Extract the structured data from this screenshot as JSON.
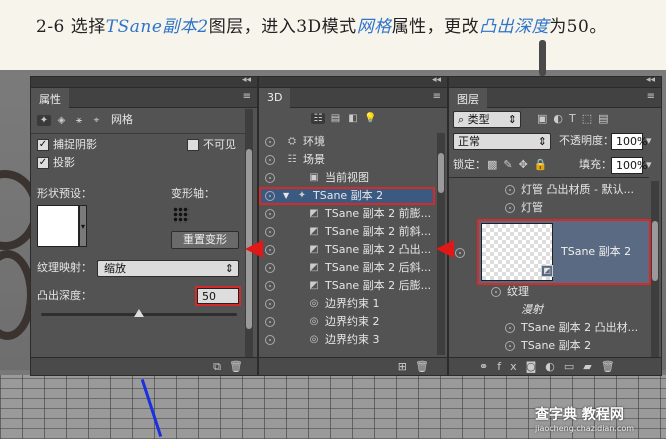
{
  "caption": {
    "prefix": "2-6 选择",
    "layer": "TSane副本2",
    "mid": "图层，进入3D模式",
    "mesh": "网格",
    "mid2": "属性，更改",
    "depth": "凸出深度",
    "suffix": "为50。"
  },
  "properties": {
    "tab": "属性",
    "mode_label": "网格",
    "catch_shadows": "捕捉阴影",
    "invisible": "不可见",
    "cast_shadows": "投影",
    "shape_preset": "形状预设：",
    "deform_axis": "变形轴：",
    "reset_button": "重置变形",
    "texture_label": "纹理映射：",
    "texture_value": "缩放",
    "extrusion_label": "凸出深度：",
    "extrusion_value": "50",
    "slider_fraction": 0.5
  },
  "panel3d": {
    "tab": "3D",
    "items": [
      {
        "icon": "env-icon",
        "label": "环境",
        "indent": 0
      },
      {
        "icon": "scene-icon",
        "label": "场景",
        "indent": 0
      },
      {
        "icon": "camera-icon",
        "label": "当前视图",
        "indent": 1
      },
      {
        "icon": "mesh-icon",
        "label": "TSane 副本 2",
        "indent": 0,
        "selected": true
      },
      {
        "icon": "material-icon",
        "label": "TSane 副本 2 前膨...",
        "indent": 1
      },
      {
        "icon": "material-icon",
        "label": "TSane 副本 2 前斜...",
        "indent": 1
      },
      {
        "icon": "material-icon",
        "label": "TSane 副本 2 凸出...",
        "indent": 1
      },
      {
        "icon": "material-icon",
        "label": "TSane 副本 2 后斜...",
        "indent": 1
      },
      {
        "icon": "material-icon",
        "label": "TSane 副本 2 后膨...",
        "indent": 1
      },
      {
        "icon": "constraint-icon",
        "label": "边界约束 1",
        "indent": 1
      },
      {
        "icon": "constraint-icon",
        "label": "边界约束 2",
        "indent": 1
      },
      {
        "icon": "constraint-icon",
        "label": "边界约束 3",
        "indent": 1
      }
    ]
  },
  "layers": {
    "tab": "图层",
    "kind": "类型",
    "blend": "正常",
    "opacity_label": "不透明度：",
    "opacity": "100%",
    "lock_label": "锁定：",
    "fill_label": "填充：",
    "fill": "100%",
    "items": [
      {
        "label": "灯管 凸出材质 - 默认...",
        "indent": 2
      },
      {
        "label": "灯管",
        "indent": 2
      }
    ],
    "selected_layer": "TSane 副本 2",
    "after": [
      {
        "label": "纹理",
        "indent": 1
      },
      {
        "label": "漫射",
        "indent": 2,
        "italic": true
      },
      {
        "label": "TSane 副本 2 凸出材...",
        "indent": 2
      },
      {
        "label": "TSane 副本 2",
        "indent": 2
      }
    ]
  },
  "watermark": {
    "main": "查字典 教程网",
    "sub": "jiaocheng.chazidian.com"
  }
}
